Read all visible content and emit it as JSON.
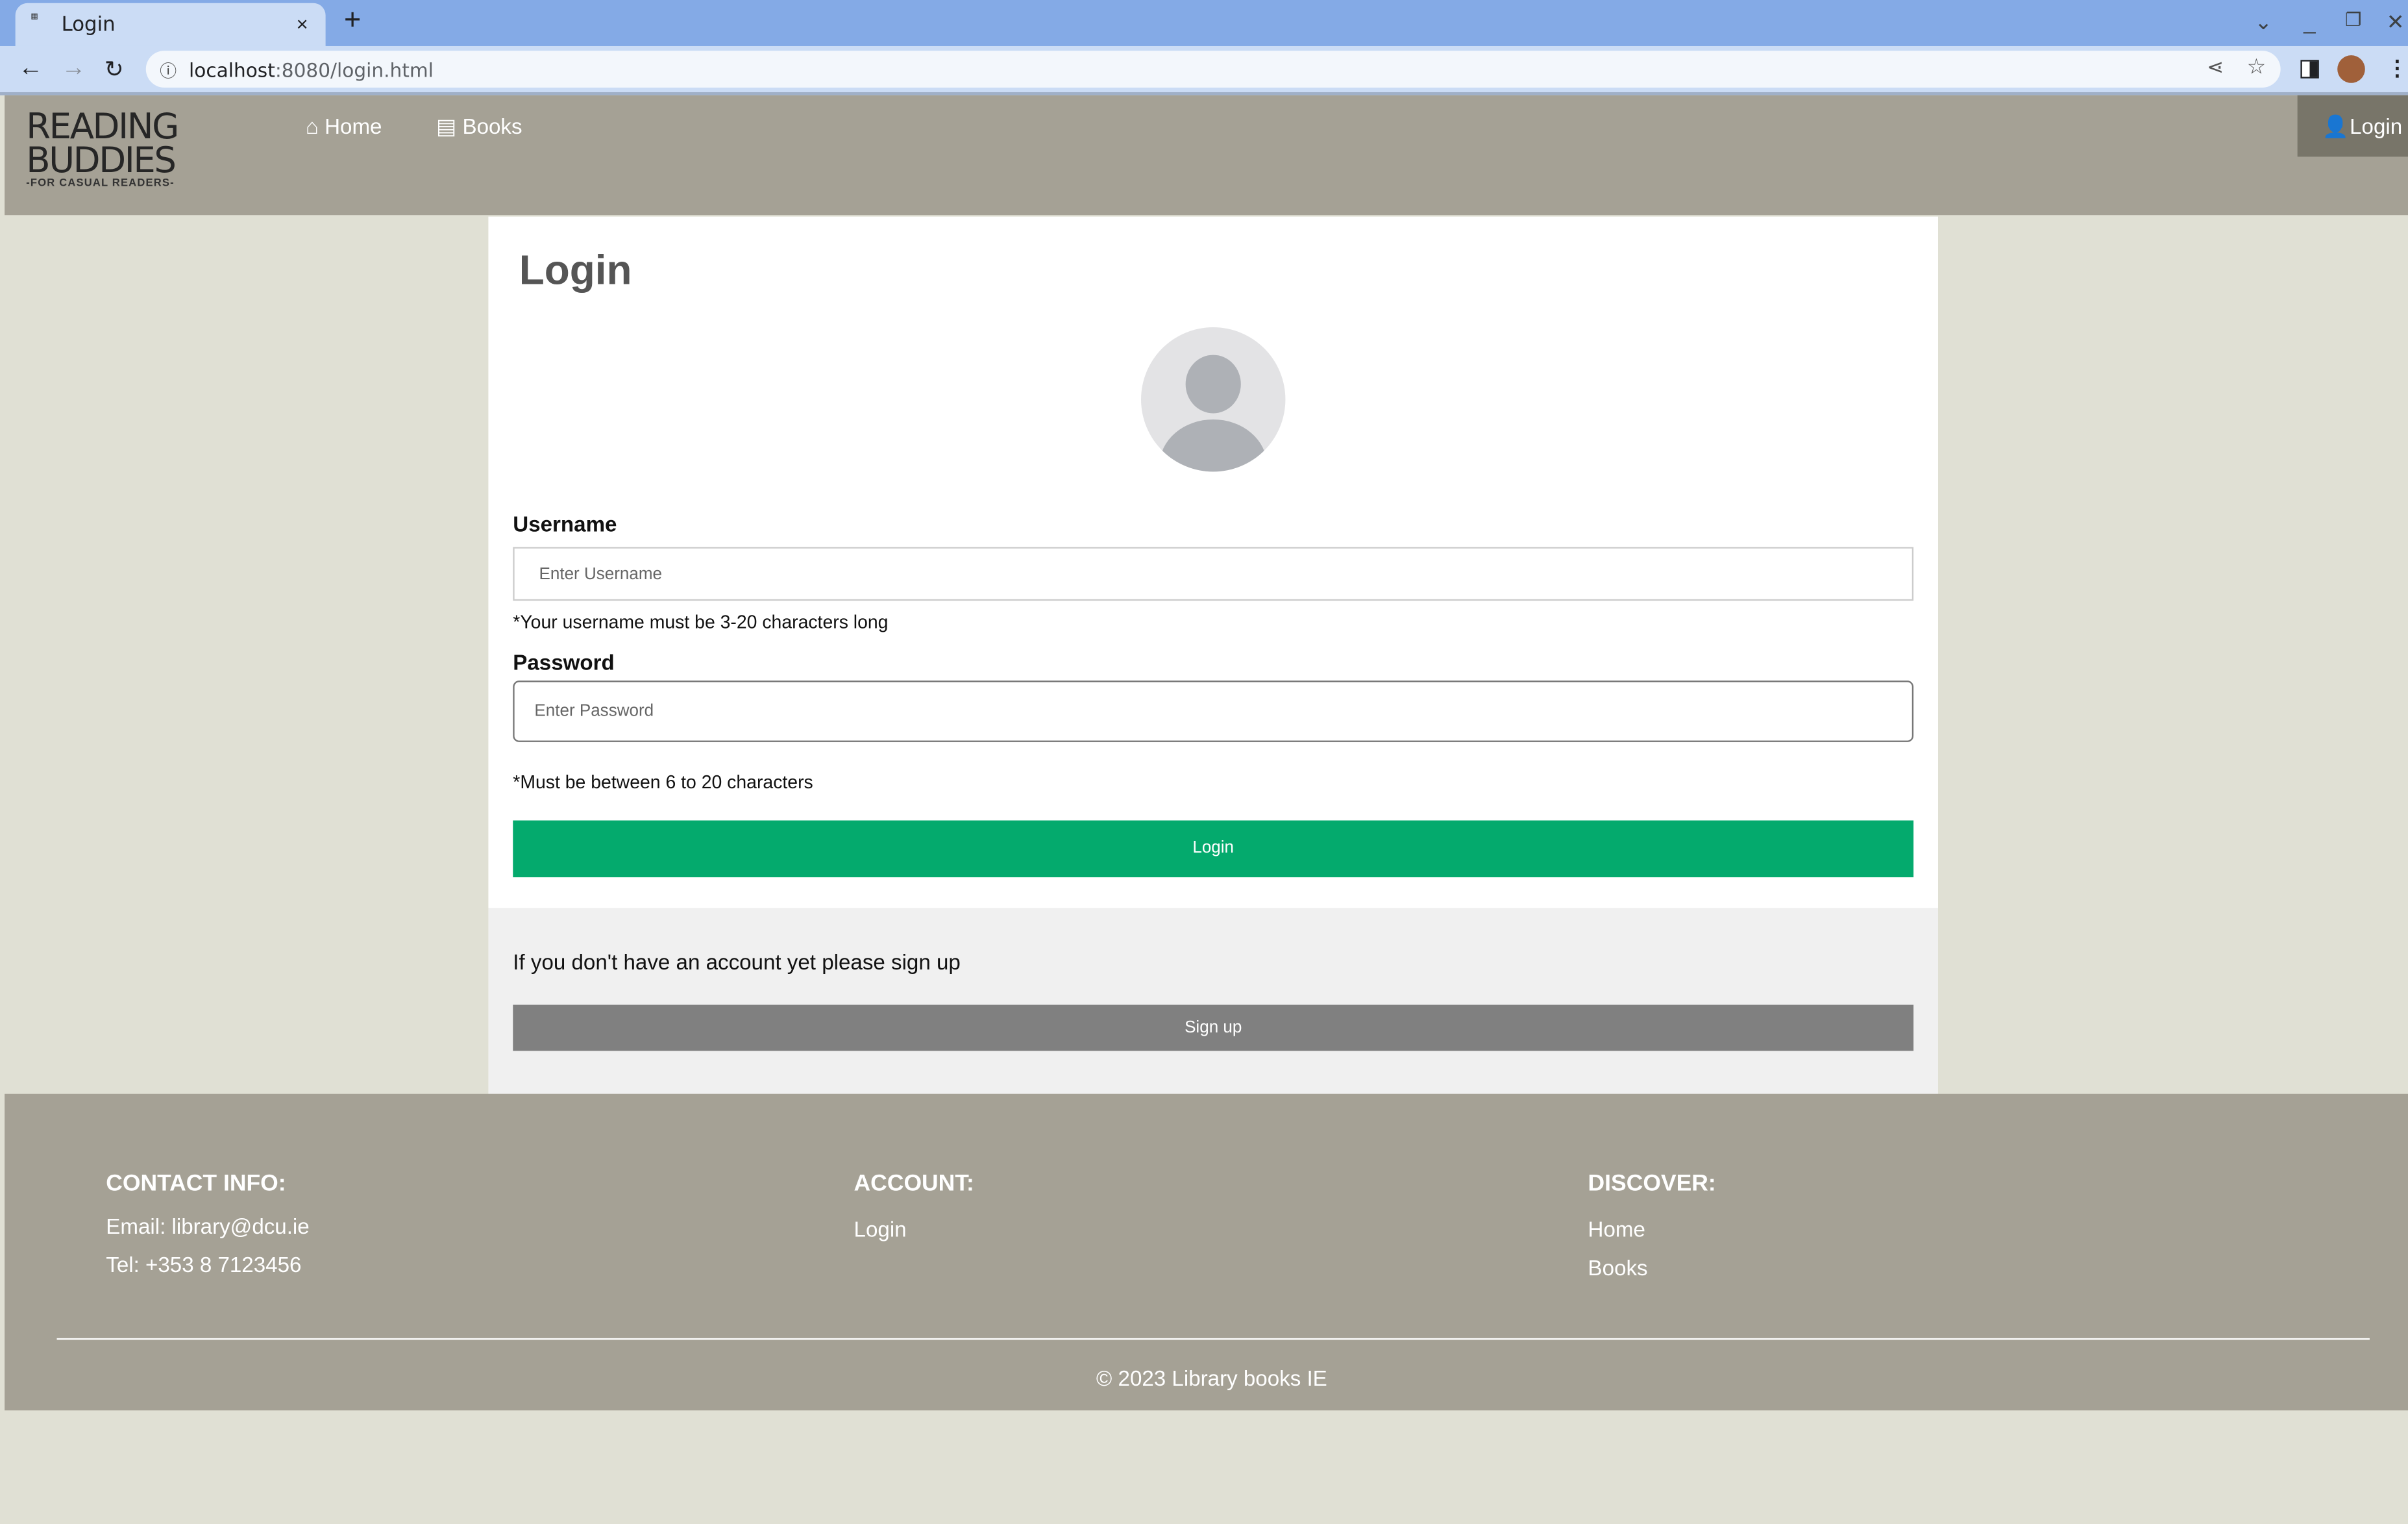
{
  "browser": {
    "tab_title": "Login",
    "url_host": "localhost",
    "url_path": ":8080/login.html",
    "new_tab": "+",
    "close_tab": "×"
  },
  "header": {
    "logo_line1": "READING",
    "logo_line2": "BUDDIES",
    "logo_tagline": "-FOR CASUAL READERS-",
    "nav": [
      {
        "label": "Home",
        "icon": "home-icon"
      },
      {
        "label": "Books",
        "icon": "book-icon"
      }
    ],
    "login": "Login"
  },
  "form": {
    "title": "Login",
    "username_label": "Username",
    "username_placeholder": "Enter Username",
    "username_value": "",
    "username_hint": "*Your username must be 3-20 characters long",
    "password_label": "Password",
    "password_placeholder": "Enter Password",
    "password_value": "",
    "password_hint": "*Must be between 6 to 20 characters",
    "submit": "Login",
    "submit_color": "#04aa6d"
  },
  "signup": {
    "text": "If you don't have an account yet please sign up",
    "button": "Sign up"
  },
  "footer": {
    "contact_title": "CONTACT INFO:",
    "email": "Email: library@dcu.ie",
    "tel": "Tel: +353 8 7123456",
    "account_title": "ACCOUNT:",
    "account_links": [
      "Login"
    ],
    "discover_title": "DISCOVER:",
    "discover_links": [
      "Home",
      "Books"
    ],
    "copyright": "© 2023 Library books IE"
  }
}
